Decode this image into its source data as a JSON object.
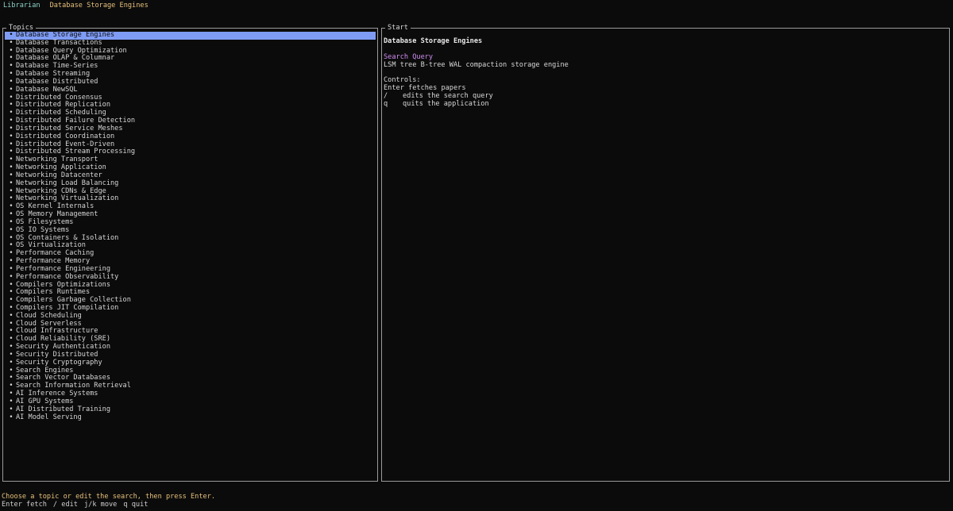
{
  "header": {
    "app_name": "Librarian",
    "title": "Database Storage Engines"
  },
  "topics_panel": {
    "title": "Topics",
    "bullet": "•",
    "selected_index": 0,
    "items": [
      "Database Storage Engines",
      "Database Transactions",
      "Database Query Optimization",
      "Database OLAP & Columnar",
      "Database Time-Series",
      "Database Streaming",
      "Database Distributed",
      "Database NewSQL",
      "Distributed Consensus",
      "Distributed Replication",
      "Distributed Scheduling",
      "Distributed Failure Detection",
      "Distributed Service Meshes",
      "Distributed Coordination",
      "Distributed Event-Driven",
      "Distributed Stream Processing",
      "Networking Transport",
      "Networking Application",
      "Networking Datacenter",
      "Networking Load Balancing",
      "Networking CDNs & Edge",
      "Networking Virtualization",
      "OS Kernel Internals",
      "OS Memory Management",
      "OS Filesystems",
      "OS IO Systems",
      "OS Containers & Isolation",
      "OS Virtualization",
      "Performance Caching",
      "Performance Memory",
      "Performance Engineering",
      "Performance Observability",
      "Compilers Optimizations",
      "Compilers Runtimes",
      "Compilers Garbage Collection",
      "Compilers JIT Compilation",
      "Cloud Scheduling",
      "Cloud Serverless",
      "Cloud Infrastructure",
      "Cloud Reliability (SRE)",
      "Security Authentication",
      "Security Distributed",
      "Security Cryptography",
      "Search Engines",
      "Search Vector Databases",
      "Search Information Retrieval",
      "AI Inference Systems",
      "AI GPU Systems",
      "AI Distributed Training",
      "AI Model Serving"
    ]
  },
  "start_panel": {
    "title": "Start",
    "heading": "Database Storage Engines",
    "search_label": "Search Query",
    "search_query": "LSM tree B-tree WAL compaction storage engine",
    "controls_label": "Controls:",
    "controls": [
      {
        "key": "Enter",
        "desc": "fetches papers"
      },
      {
        "key": "/",
        "desc": "edits the search query"
      },
      {
        "key": "q",
        "desc": "quits the application"
      }
    ]
  },
  "footer": {
    "status": "Choose a topic or edit the search, then press Enter.",
    "hints": [
      "Enter fetch",
      "/ edit",
      "j/k move",
      "q quit"
    ]
  },
  "colors": {
    "background": "#0b0b0b",
    "selected_bg": "#7f9cf5",
    "accent_yellow": "#e6c07b",
    "accent_purple": "#d08cf0",
    "accent_teal": "#8fd1c7"
  }
}
